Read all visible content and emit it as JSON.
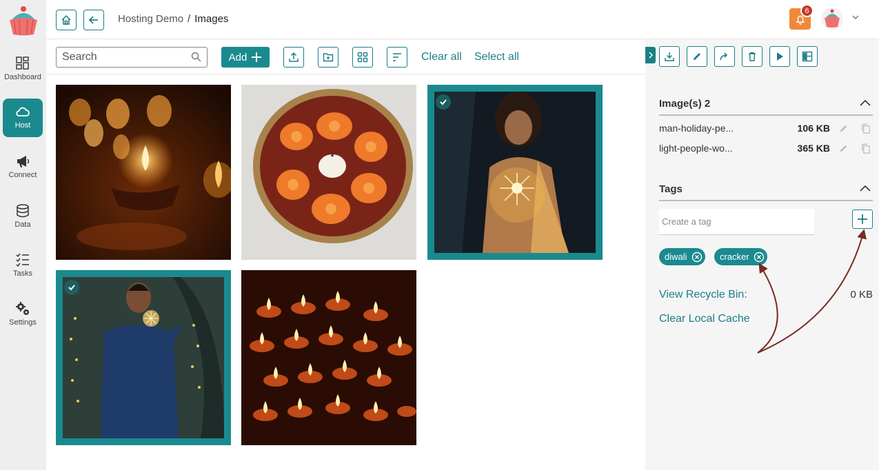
{
  "sidebar": {
    "items": [
      {
        "label": "Dashboard",
        "icon": "dashboard-icon"
      },
      {
        "label": "Host",
        "icon": "cloud-icon",
        "active": true
      },
      {
        "label": "Connect",
        "icon": "megaphone-icon"
      },
      {
        "label": "Data",
        "icon": "database-icon"
      },
      {
        "label": "Tasks",
        "icon": "checklist-icon"
      },
      {
        "label": "Settings",
        "icon": "gears-icon"
      }
    ]
  },
  "header": {
    "breadcrumb": {
      "parent": "Hosting Demo",
      "separator": "/",
      "current": "Images"
    },
    "notification_count": "6"
  },
  "toolbar": {
    "search_placeholder": "Search",
    "add_label": "Add",
    "clear_all": "Clear all",
    "select_all": "Select all"
  },
  "grid": {
    "images": [
      {
        "name": "oil-lamps-bokeh",
        "selected": false
      },
      {
        "name": "flower-bowl-candle",
        "selected": false
      },
      {
        "name": "woman-sparklers",
        "selected": true
      },
      {
        "name": "man-holiday-sparkler",
        "selected": true
      },
      {
        "name": "many-diyas",
        "selected": false
      }
    ]
  },
  "panel": {
    "images_title": "Image(s) 2",
    "files": [
      {
        "name": "man-holiday-pe...",
        "size": "106 KB"
      },
      {
        "name": "light-people-wo...",
        "size": "365 KB"
      }
    ],
    "tags_title": "Tags",
    "tag_placeholder": "Create a tag",
    "tags": [
      "diwali",
      "cracker"
    ],
    "recycle_label": "View Recycle Bin:",
    "recycle_value": "0 KB",
    "clear_cache": "Clear Local Cache"
  },
  "colors": {
    "accent": "#1b8a8f",
    "notification": "#f0883a",
    "badge": "#c0392b",
    "annotation_arrow": "#7a2a22"
  }
}
